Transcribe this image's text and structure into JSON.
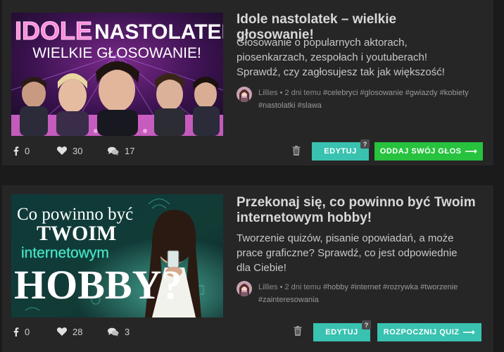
{
  "posts": [
    {
      "title": "Idole nastolatek – wielkie głosowanie!",
      "description": "Głosowanie o popularnych aktorach, piosenkarzach, zespołach i youtuberach! Sprawdź, czy zagłosujesz tak jak większość!",
      "thumb_text": {
        "word1": "IDOLE",
        "word2": "NASTOLATEK",
        "line2": "WIELKIE GŁOSOWANIE!"
      },
      "author": "Lillies",
      "time": "2 dni temu",
      "tags": [
        "#celebryci",
        "#glosowanie",
        "#gwiazdy",
        "#kobiety",
        "#nastolatki",
        "#slawa"
      ],
      "shares": "0",
      "likes": "30",
      "comments": "17",
      "edit_label": "EDYTUJ",
      "help_badge": "?",
      "action_label": "ODDAJ SWÓJ GŁOS",
      "action_arrow": "⟶"
    },
    {
      "title": "Przekonaj się, co powinno być Twoim internetowym hobby!",
      "description": "Tworzenie quizów, pisanie opowiadań, a może prace graficzne? Sprawdź, co jest odpowiednie dla Ciebie!",
      "thumb_text": {
        "line1": "Co powinno być",
        "line2": "TWOIM",
        "line3": "internetowym",
        "line4": "HOBBY?"
      },
      "author": "Lillies",
      "time": "2 dni temu",
      "tags": [
        "#hobby",
        "#internet",
        "#rozrywka",
        "#tworzenie",
        "#zainteresowania"
      ],
      "shares": "0",
      "likes": "28",
      "comments": "3",
      "edit_label": "EDYTUJ",
      "help_badge": "?",
      "action_label": "ROZPOCZNIJ QUIZ",
      "action_arrow": "⟶"
    }
  ],
  "meta_separator": "•",
  "colors": {
    "background": "#1b1b1b",
    "card": "#262626",
    "edit_button": "#39c2b0",
    "vote_button": "#27c23e",
    "quiz_button": "#39c2b0"
  },
  "icons": {
    "share": "facebook-icon",
    "like": "heart-icon",
    "comment": "comments-icon",
    "delete": "trash-icon",
    "arrow": "arrow-right-icon"
  }
}
